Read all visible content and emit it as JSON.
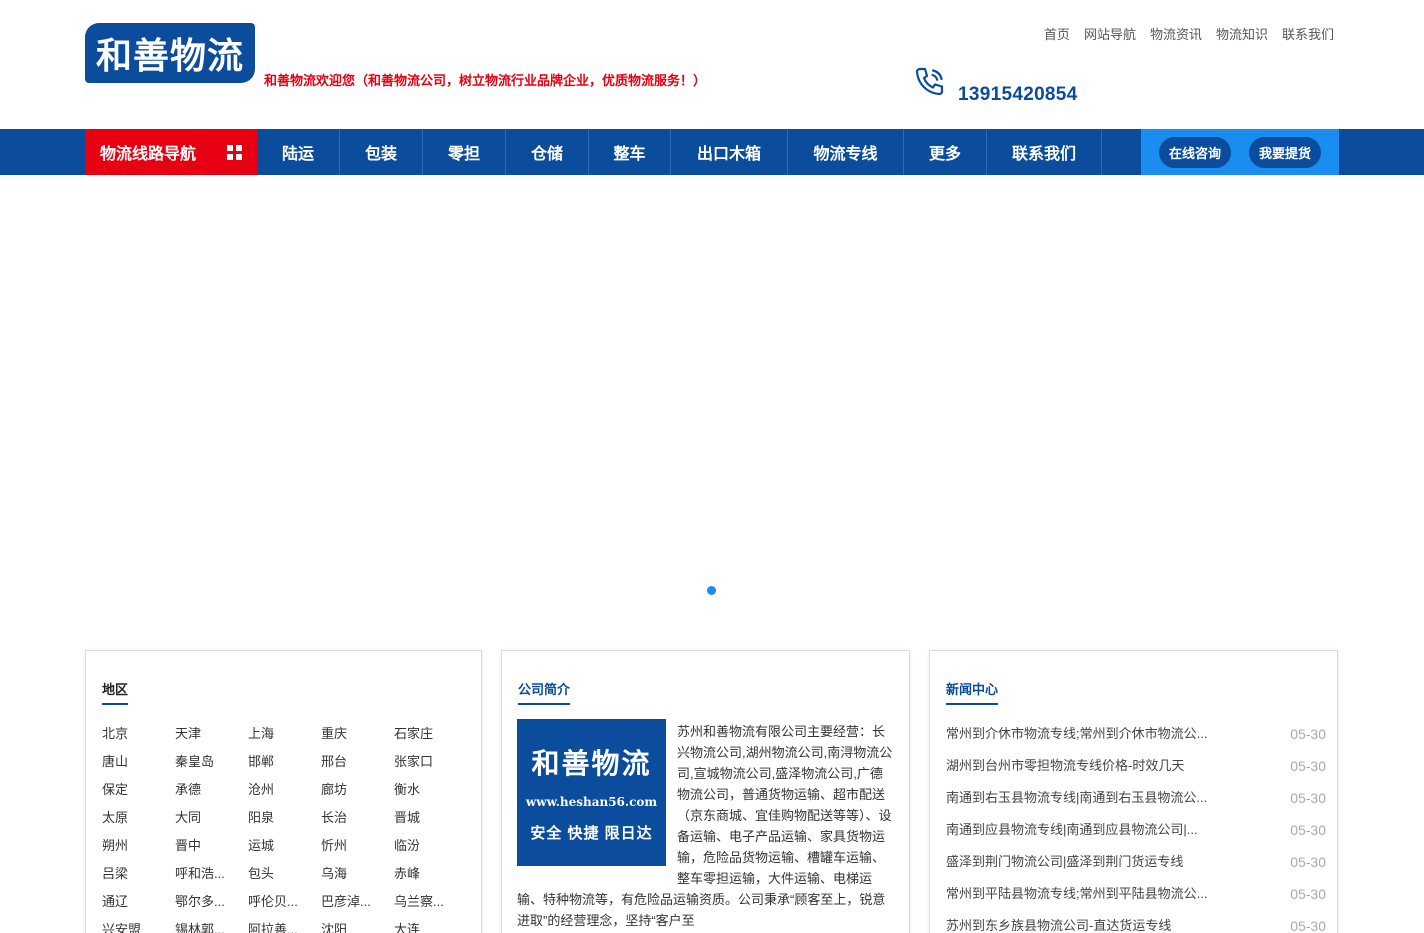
{
  "header": {
    "logo_text": "和善物流",
    "slogan": "和善物流欢迎您（和善物流公司，树立物流行业品牌企业，优质物流服务！）",
    "top_links": [
      "首页",
      "网站导航",
      "物流资讯",
      "物流知识",
      "联系我们"
    ],
    "phone": "13915420854",
    "phone_icon": "phone-icon"
  },
  "nav": {
    "category_label": "物流线路导航",
    "items": [
      "陆运",
      "包装",
      "零担",
      "仓储",
      "整车",
      "出口木箱",
      "物流专线",
      "更多",
      "联系我们"
    ],
    "consult": "在线咨询",
    "pickup": "我要提货"
  },
  "regions": {
    "title": "地区",
    "items": [
      "北京",
      "天津",
      "上海",
      "重庆",
      "石家庄",
      "唐山",
      "秦皇岛",
      "邯郸",
      "邢台",
      "张家口",
      "保定",
      "承德",
      "沧州",
      "廊坊",
      "衡水",
      "太原",
      "大同",
      "阳泉",
      "长治",
      "晋城",
      "朔州",
      "晋中",
      "运城",
      "忻州",
      "临汾",
      "吕梁",
      "呼和浩...",
      "包头",
      "乌海",
      "赤峰",
      "通辽",
      "鄂尔多...",
      "呼伦贝...",
      "巴彦淖...",
      "乌兰察...",
      "兴安盟",
      "锡林郭...",
      "阿拉善...",
      "沈阳",
      "大连"
    ]
  },
  "about": {
    "title": "公司简介",
    "logo_line1": "和善物流",
    "logo_line2": "www.heshan56.com",
    "logo_line3": "安全 快捷 限日达",
    "text": "苏州和善物流有限公司主要经营：长兴物流公司,湖州物流公司,南浔物流公司,宣城物流公司,盛泽物流公司,广德物流公司，普通货物运输、超市配送（京东商城、宜佳购物配送等等）、设备运输、电子产品运输、家具货物运输，危险品货物运输、槽罐车运输、整车零担运输，大件运输、电梯运输、特种物流等，有危险品运输资质。公司秉承“顾客至上，锐意进取”的经营理念，坚持“客户至"
  },
  "news": {
    "title": "新闻中心",
    "items": [
      {
        "title": "常州到介休市物流专线;常州到介休市物流公...",
        "date": "05-30"
      },
      {
        "title": "湖州到台州市零担物流专线价格-时效几天",
        "date": "05-30"
      },
      {
        "title": "南通到右玉县物流专线|南通到右玉县物流公...",
        "date": "05-30"
      },
      {
        "title": "南通到应县物流专线|南通到应县物流公司|...",
        "date": "05-30"
      },
      {
        "title": "盛泽到荆门物流公司|盛泽到荆门货运专线",
        "date": "05-30"
      },
      {
        "title": "常州到平陆县物流专线;常州到平陆县物流公...",
        "date": "05-30"
      },
      {
        "title": "苏州到东乡族县物流公司-直达货运专线",
        "date": "05-30"
      }
    ]
  },
  "colors": {
    "primary": "#0b4c9c",
    "accent": "#e60012",
    "light_blue": "#1a8ef0"
  }
}
